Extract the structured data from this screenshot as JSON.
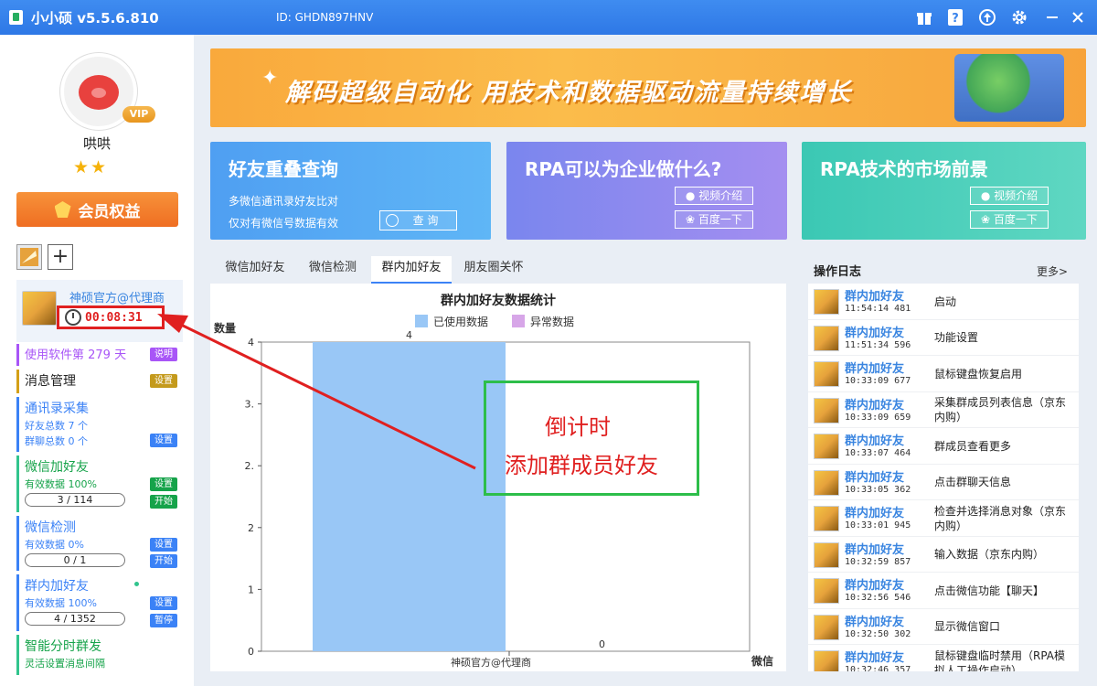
{
  "titlebar": {
    "app_name": "小小硕  v5.5.6.810",
    "id_label": "ID: GHDN897HNV"
  },
  "profile": {
    "username": "哄哄",
    "vip": "VIP",
    "stars": "★★",
    "member_button": "会员权益"
  },
  "account": {
    "name": "神硕官方@代理商",
    "timer": "00:08:31"
  },
  "menu": {
    "usage": {
      "title": "使用软件第 279 天",
      "pill": "说明"
    },
    "messages": {
      "title": "消息管理",
      "pill": "设置"
    },
    "contacts": {
      "title": "通讯录采集",
      "line1": "好友总数 7 个",
      "line2": "群聊总数 0 个",
      "pill": "设置"
    },
    "wechat_add": {
      "title": "微信加好友",
      "line1": "有效数据 100%",
      "progress": "3 / 114",
      "pill1": "设置",
      "pill2": "开始",
      "progress_fraction": 0.026
    },
    "wechat_check": {
      "title": "微信检测",
      "line1": "有效数据 0%",
      "progress": "0 / 1",
      "pill1": "设置",
      "pill2": "开始",
      "progress_fraction": 0
    },
    "group_add": {
      "title": "群内加好友",
      "line1": "有效数据 100%",
      "progress": "4 / 1352",
      "pill1": "设置",
      "pill2": "暂停",
      "progress_fraction": 0.003
    },
    "smart_group": {
      "title": "智能分时群发",
      "line1": "灵活设置消息间隔"
    }
  },
  "banner": {
    "text": "解码超级自动化  用技术和数据驱动流量持续增长"
  },
  "cards": [
    {
      "title": "好友重叠查询",
      "line1": "多微信通讯录好友比对",
      "line2": "仅对有微信号数据有效",
      "button": "查 询"
    },
    {
      "title": "RPA可以为企业做什么?",
      "button1": "视频介绍",
      "button2": "百度一下"
    },
    {
      "title": "RPA技术的市场前景",
      "button1": "视频介绍",
      "button2": "百度一下"
    }
  ],
  "tabs": [
    "微信加好友",
    "微信检测",
    "群内加好友",
    "朋友圈关怀"
  ],
  "active_tab": 2,
  "chart_data": {
    "type": "bar",
    "title": "群内加好友数据统计",
    "ylabel": "数量",
    "xlabel": "微信",
    "categories": [
      "神硕官方@代理商"
    ],
    "series": [
      {
        "name": "已使用数据",
        "values": [
          4
        ],
        "color": "#99c7f6"
      },
      {
        "name": "异常数据",
        "values": [
          0
        ],
        "color": "#d7a6e8"
      }
    ],
    "ylim": [
      0,
      4
    ],
    "yticks": [
      "0",
      "1",
      "2",
      "2.",
      "3.",
      "4"
    ],
    "data_labels": [
      "4",
      "0"
    ],
    "legend_position": "top"
  },
  "log": {
    "title": "操作日志",
    "more": "更多>",
    "items": [
      {
        "name": "群内加好友",
        "time": "11:54:14 481",
        "msg": "启动"
      },
      {
        "name": "群内加好友",
        "time": "11:51:34 596",
        "msg": "功能设置"
      },
      {
        "name": "群内加好友",
        "time": "10:33:09 677",
        "msg": "鼠标键盘恢复启用"
      },
      {
        "name": "群内加好友",
        "time": "10:33:09 659",
        "msg": "采集群成员列表信息（京东内购）"
      },
      {
        "name": "群内加好友",
        "time": "10:33:07 464",
        "msg": "群成员查看更多"
      },
      {
        "name": "群内加好友",
        "time": "10:33:05 362",
        "msg": "点击群聊天信息"
      },
      {
        "name": "群内加好友",
        "time": "10:33:01 945",
        "msg": "检查并选择消息对象（京东内购）"
      },
      {
        "name": "群内加好友",
        "time": "10:32:59 857",
        "msg": "输入数据（京东内购）"
      },
      {
        "name": "群内加好友",
        "time": "10:32:56 546",
        "msg": "点击微信功能【聊天】"
      },
      {
        "name": "群内加好友",
        "time": "10:32:50 302",
        "msg": "显示微信窗口"
      },
      {
        "name": "群内加好友",
        "time": "10:32:46 357",
        "msg": "鼠标键盘临时禁用（RPA模拟人工操作启动）"
      }
    ]
  },
  "annotation": {
    "line1": "倒计时",
    "line2": "添加群成员好友"
  },
  "colors": {
    "titlebar": "#3a84ec",
    "accent": "#3b82f6",
    "annotation_red": "#e02020",
    "annotation_green": "#2dbe4a"
  }
}
